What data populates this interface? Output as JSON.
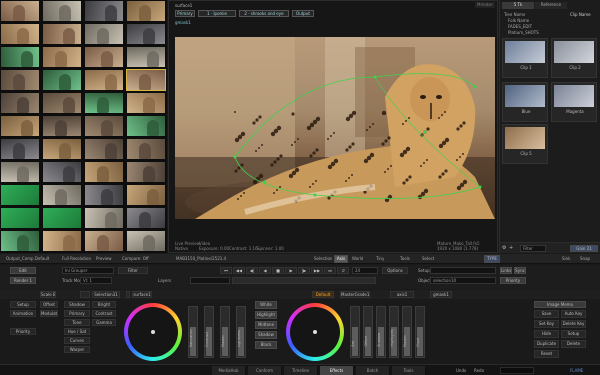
{
  "viewer": {
    "layer_title": "surface1",
    "tabs": [
      "Primary",
      "1 · Ipomie",
      "2 · shrooks and eye",
      "Output"
    ],
    "gmask_label": "gmask1",
    "top_right": "Mmaker",
    "info_left": [
      "Live Preview",
      "Native"
    ],
    "info_mid": [
      "Video",
      "Exposure: 0.00",
      "Contrast: 1.16",
      "Spinner: 1.00"
    ],
    "info_right": [
      "Mature_Mako_Tall.fx5",
      "1920 x 1080 (1.778)"
    ]
  },
  "media": {
    "tab_active": "5 Tk",
    "tab_other": "Reference",
    "sort_label": "Clip Name",
    "filter_label": "Tree Name",
    "tree": [
      "Folk Name",
      "FADES_EDIT",
      "Platium_SHOTS"
    ],
    "cards": [
      {
        "label": "Clip 1"
      },
      {
        "label": "Clip 2"
      },
      {
        "label": "Blue"
      },
      {
        "label": "Magenta"
      },
      {
        "label": "Clip 5"
      }
    ],
    "bottom_tools": [
      "Filter",
      "Gain 21"
    ]
  },
  "toolbar1": {
    "items": [
      "Output_Comp Default",
      "Full Resolution",
      "Preview",
      "Compare: Off",
      "MAB3150_Platine/2521.4",
      "Selection",
      "Axis",
      "World",
      "Tiny",
      "Tools",
      "Select",
      "TYPE",
      "Sink",
      "Snap"
    ]
  },
  "toolbar2": {
    "left": [
      "Edit",
      "Render 1",
      "Track Mode",
      "Vl: 1"
    ],
    "filter_label": "Filter",
    "grouper_label": "Ini Grouper",
    "layer_label": "Layers",
    "frame": "24",
    "options_label": "Options",
    "setup_label": "Setup",
    "object_label": "Object",
    "object_value": "selection10",
    "links_label": "Links",
    "sync_label": "Sync",
    "priority_label": "Priority"
  },
  "tabs": {
    "items": [
      "Scale Bk",
      "",
      "Selection31",
      "",
      "surface1",
      "Default",
      "MasterGrade1",
      "axis1",
      "gmask1"
    ]
  },
  "controls_left": {
    "col1": [
      "Setup",
      "Animation",
      "",
      "Priority"
    ],
    "col2": [
      "Offset",
      "Modulate",
      "",
      ""
    ],
    "col3": [
      "Shadow",
      "Primary",
      "Tone",
      "Hue / Sat",
      "Curves",
      "Warper"
    ],
    "col4": [
      "Bright",
      "Contrast",
      "Gamma",
      "",
      "",
      ""
    ]
  },
  "wheel1_buttons": [
    "White",
    "Highlight",
    "Midtone",
    "Shadow",
    "Black"
  ],
  "faders1": [
    "Saturation",
    "Contrast",
    "Master",
    "Lightness"
  ],
  "faders2": [
    "Sat",
    "Offset",
    "Shadow",
    "Highlights",
    "Master",
    "Pivot"
  ],
  "right_buttons": {
    "top": "Image Memo",
    "rows": [
      [
        "Save",
        "Auto Key"
      ],
      [
        "Set Key",
        "Delete Key"
      ],
      [
        "Hide",
        "Setup"
      ],
      [
        "Duplicate",
        "Delete"
      ],
      [
        "Reset",
        ""
      ]
    ]
  },
  "bottom_tabs": {
    "items": [
      "MediaHub",
      "Conform",
      "Timeline",
      "Effects",
      "Batch",
      "Tools"
    ],
    "active": "Effects"
  },
  "status": {
    "undo": "Undo",
    "redo": "Redo",
    "brand": "FLAME"
  },
  "colors": {
    "accent_green": "#3fd24a",
    "viewer_border": "#3a3a3a",
    "active_tab": "#444444"
  }
}
